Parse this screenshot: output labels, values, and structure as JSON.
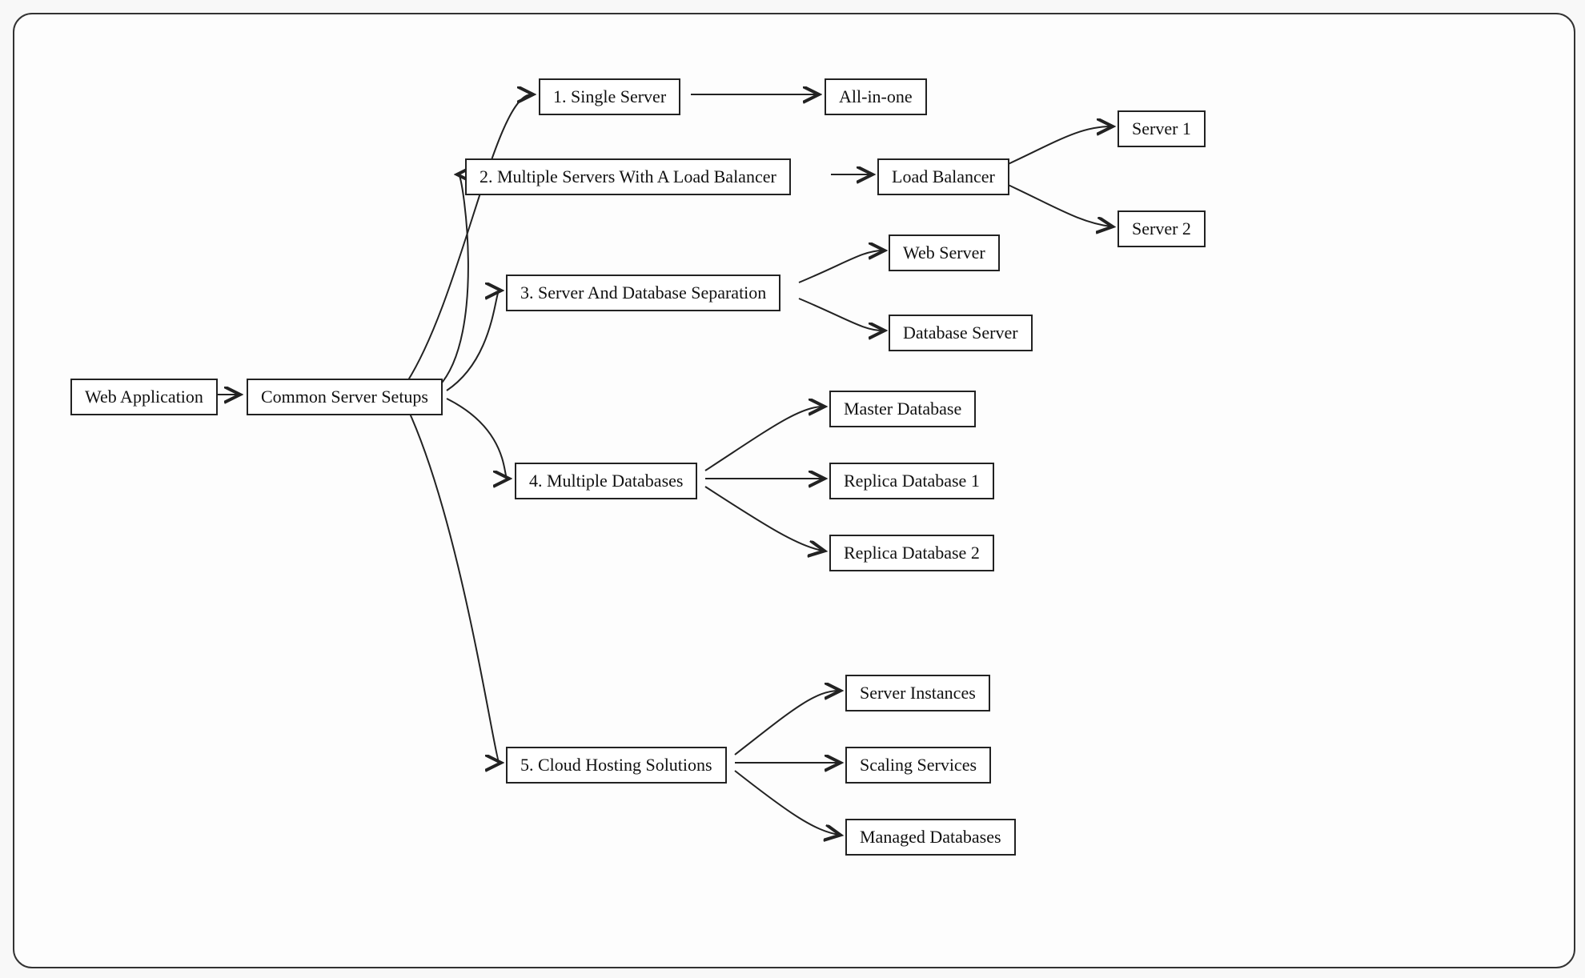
{
  "diagram": {
    "root1": "Web Application",
    "root2": "Common Server Setups",
    "n1": "1. Single Server",
    "n1a": "All-in-one",
    "n2": "2. Multiple Servers With A Load Balancer",
    "n2a": "Load Balancer",
    "n2a1": "Server 1",
    "n2a2": "Server 2",
    "n3": "3. Server And Database Separation",
    "n3a": "Web Server",
    "n3b": "Database Server",
    "n4": "4. Multiple Databases",
    "n4a": "Master Database",
    "n4b": "Replica Database 1",
    "n4c": "Replica Database 2",
    "n5": "5. Cloud Hosting Solutions",
    "n5a": "Server Instances",
    "n5b": "Scaling Services",
    "n5c": "Managed Databases"
  }
}
